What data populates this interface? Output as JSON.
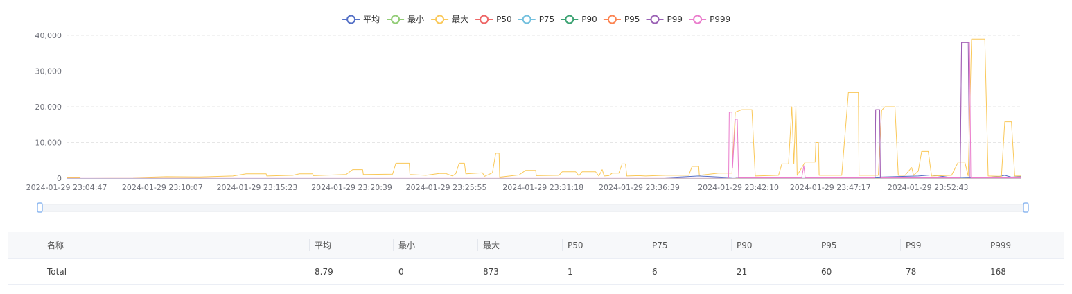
{
  "chart_data": {
    "type": "line",
    "ylim": [
      0,
      40000
    ],
    "yticks": [
      "40,000",
      "30,000",
      "20,000",
      "10,000",
      "0"
    ],
    "ytick_values": [
      40000,
      30000,
      20000,
      10000,
      0
    ],
    "xtick_labels": [
      "2024-01-29 23:04:47",
      "2024-01-29 23:10:07",
      "2024-01-29 23:15:23",
      "2024-01-29 23:20:39",
      "2024-01-29 23:25:55",
      "2024-01-29 23:31:18",
      "2024-01-29 23:36:39",
      "2024-01-29 23:42:10",
      "2024-01-29 23:47:17",
      "2024-01-29 23:52:43"
    ],
    "x_range": [
      "2024-01-29 23:04:47",
      "2024-01-29 23:57:55"
    ],
    "grid": true,
    "legend_position": "top-center",
    "series": [
      {
        "name": "平均",
        "color": "#5470c6",
        "points": [
          [
            0,
            30
          ],
          [
            100,
            40
          ],
          [
            200,
            50
          ],
          [
            300,
            60
          ],
          [
            400,
            70
          ],
          [
            500,
            80
          ],
          [
            600,
            80
          ],
          [
            700,
            90
          ],
          [
            800,
            100
          ],
          [
            900,
            110
          ],
          [
            950,
            600
          ],
          [
            1000,
            150
          ],
          [
            1100,
            120
          ],
          [
            1200,
            200
          ],
          [
            1280,
            600
          ],
          [
            1300,
            900
          ],
          [
            1330,
            150
          ],
          [
            1350,
            250
          ],
          [
            1365,
            300
          ],
          [
            1380,
            200
          ],
          [
            1400,
            400
          ],
          [
            1410,
            800
          ],
          [
            1420,
            300
          ],
          [
            1435,
            450
          ]
        ]
      },
      {
        "name": "最小",
        "color": "#91cc75",
        "points": [
          [
            0,
            0
          ],
          [
            1435,
            0
          ]
        ]
      },
      {
        "name": "最大",
        "color": "#fac858",
        "points": [
          [
            0,
            300
          ],
          [
            20,
            300
          ],
          [
            21,
            100
          ],
          [
            100,
            150
          ],
          [
            150,
            400
          ],
          [
            200,
            350
          ],
          [
            250,
            600
          ],
          [
            270,
            1200
          ],
          [
            300,
            1200
          ],
          [
            301,
            600
          ],
          [
            340,
            800
          ],
          [
            350,
            1200
          ],
          [
            370,
            1200
          ],
          [
            371,
            700
          ],
          [
            420,
            1000
          ],
          [
            430,
            2400
          ],
          [
            445,
            2400
          ],
          [
            446,
            1000
          ],
          [
            490,
            1100
          ],
          [
            495,
            4200
          ],
          [
            515,
            4200
          ],
          [
            516,
            1000
          ],
          [
            540,
            800
          ],
          [
            560,
            1300
          ],
          [
            570,
            1300
          ],
          [
            580,
            600
          ],
          [
            585,
            1300
          ],
          [
            590,
            4200
          ],
          [
            598,
            4200
          ],
          [
            600,
            1200
          ],
          [
            625,
            1500
          ],
          [
            628,
            500
          ],
          [
            640,
            1500
          ],
          [
            645,
            7000
          ],
          [
            650,
            7000
          ],
          [
            651,
            300
          ],
          [
            680,
            900
          ],
          [
            690,
            2200
          ],
          [
            705,
            2200
          ],
          [
            706,
            700
          ],
          [
            740,
            800
          ],
          [
            745,
            1800
          ],
          [
            765,
            1800
          ],
          [
            770,
            700
          ],
          [
            775,
            1800
          ],
          [
            795,
            1800
          ],
          [
            800,
            600
          ],
          [
            805,
            2400
          ],
          [
            808,
            600
          ],
          [
            815,
            700
          ],
          [
            820,
            1400
          ],
          [
            830,
            1400
          ],
          [
            835,
            4000
          ],
          [
            840,
            4000
          ],
          [
            842,
            600
          ],
          [
            860,
            700
          ],
          [
            870,
            600
          ],
          [
            900,
            800
          ],
          [
            935,
            800
          ],
          [
            940,
            3300
          ],
          [
            950,
            3300
          ],
          [
            951,
            800
          ],
          [
            980,
            1400
          ],
          [
            1000,
            1400
          ],
          [
            1005,
            18500
          ],
          [
            1015,
            19200
          ],
          [
            1030,
            19200
          ],
          [
            1035,
            600
          ],
          [
            1070,
            800
          ],
          [
            1075,
            4000
          ],
          [
            1085,
            4000
          ],
          [
            1090,
            20000
          ],
          [
            1093,
            4000
          ],
          [
            1096,
            20000
          ],
          [
            1098,
            800
          ],
          [
            1110,
            4500
          ],
          [
            1125,
            4500
          ],
          [
            1126,
            10000
          ],
          [
            1130,
            10000
          ],
          [
            1131,
            800
          ],
          [
            1165,
            800
          ],
          [
            1175,
            24000
          ],
          [
            1190,
            24000
          ],
          [
            1191,
            800
          ],
          [
            1220,
            800
          ],
          [
            1225,
            19000
          ],
          [
            1230,
            20000
          ],
          [
            1245,
            20000
          ],
          [
            1250,
            800
          ],
          [
            1260,
            800
          ],
          [
            1270,
            3000
          ],
          [
            1273,
            800
          ],
          [
            1280,
            2000
          ],
          [
            1285,
            7500
          ],
          [
            1295,
            7500
          ],
          [
            1300,
            600
          ],
          [
            1330,
            800
          ],
          [
            1340,
            4500
          ],
          [
            1350,
            4500
          ],
          [
            1355,
            600
          ],
          [
            1360,
            39000
          ],
          [
            1380,
            39000
          ],
          [
            1385,
            600
          ],
          [
            1405,
            500
          ],
          [
            1410,
            15800
          ],
          [
            1420,
            15800
          ],
          [
            1425,
            600
          ],
          [
            1435,
            600
          ]
        ]
      },
      {
        "name": "P50",
        "color": "#ee6666",
        "points": [
          [
            0,
            0
          ],
          [
            1435,
            0
          ]
        ]
      },
      {
        "name": "P75",
        "color": "#73c0de",
        "points": [
          [
            0,
            5
          ],
          [
            1435,
            5
          ]
        ]
      },
      {
        "name": "P90",
        "color": "#3ba272",
        "points": [
          [
            0,
            15
          ],
          [
            1435,
            15
          ]
        ]
      },
      {
        "name": "P95",
        "color": "#fc8452",
        "points": [
          [
            0,
            30
          ],
          [
            1435,
            30
          ]
        ]
      },
      {
        "name": "P99",
        "color": "#9a60b4",
        "points": [
          [
            0,
            60
          ],
          [
            1005,
            60
          ],
          [
            1006,
            200
          ],
          [
            1010,
            200
          ],
          [
            1011,
            60
          ],
          [
            1215,
            60
          ],
          [
            1216,
            19200
          ],
          [
            1222,
            19200
          ],
          [
            1223,
            60
          ],
          [
            1343,
            60
          ],
          [
            1345,
            38000
          ],
          [
            1355,
            38000
          ],
          [
            1357,
            60
          ],
          [
            1435,
            60
          ]
        ]
      },
      {
        "name": "P999",
        "color": "#ea7ccc",
        "points": [
          [
            0,
            120
          ],
          [
            995,
            120
          ],
          [
            996,
            18500
          ],
          [
            1000,
            18500
          ],
          [
            1001,
            3000
          ],
          [
            1005,
            16500
          ],
          [
            1008,
            16500
          ],
          [
            1010,
            300
          ],
          [
            1105,
            300
          ],
          [
            1108,
            3500
          ],
          [
            1110,
            300
          ],
          [
            1215,
            300
          ],
          [
            1216,
            19200
          ],
          [
            1222,
            19200
          ],
          [
            1223,
            300
          ],
          [
            1343,
            300
          ],
          [
            1345,
            38000
          ],
          [
            1357,
            38000
          ],
          [
            1359,
            300
          ],
          [
            1435,
            300
          ]
        ]
      }
    ]
  },
  "table": {
    "headers": [
      "名称",
      "平均",
      "最小",
      "最大",
      "P50",
      "P75",
      "P90",
      "P95",
      "P99",
      "P999"
    ],
    "rows": [
      [
        "Total",
        "8.79",
        "0",
        "873",
        "1",
        "6",
        "21",
        "60",
        "78",
        "168"
      ]
    ]
  }
}
